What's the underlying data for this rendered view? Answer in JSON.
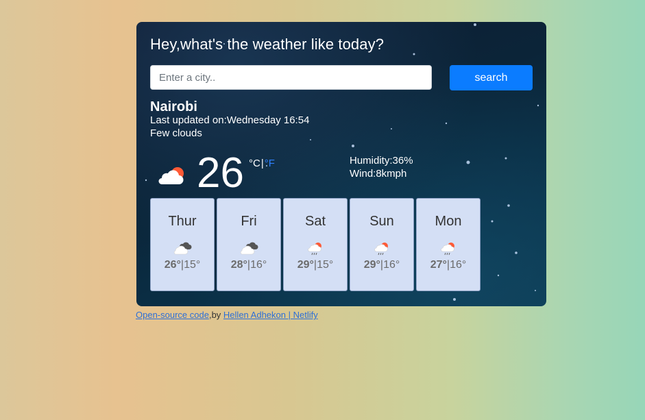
{
  "app": {
    "heading": "Hey,what's the weather like today?"
  },
  "search": {
    "placeholder": "Enter a city..",
    "value": "",
    "button_label": "search"
  },
  "current": {
    "city": "Nairobi",
    "last_updated": "Last updated on:Wednesday 16:54",
    "description": "Few clouds",
    "icon": "few-clouds-day-icon",
    "temperature": "26",
    "unit_celsius": "°C",
    "unit_separator": "|",
    "unit_fahrenheit": "°F",
    "humidity": "Humidity:36%",
    "wind": "Wind:8kmph"
  },
  "forecast": [
    {
      "day": "Thur",
      "icon": "broken-clouds-icon",
      "max": "26°",
      "min": "15°"
    },
    {
      "day": "Fri",
      "icon": "broken-clouds-icon",
      "max": "28°",
      "min": "16°"
    },
    {
      "day": "Sat",
      "icon": "rain-icon",
      "max": "29°",
      "min": "15°"
    },
    {
      "day": "Sun",
      "icon": "rain-icon",
      "max": "29°",
      "min": "16°"
    },
    {
      "day": "Mon",
      "icon": "rain-icon",
      "max": "27°",
      "min": "16°"
    }
  ],
  "footer": {
    "source_link": "Open-source code",
    "by_text": ",by ",
    "author_link": "Hellen Adhekon",
    "host_link": " | Netlify"
  },
  "colors": {
    "accent": "#0b7cff",
    "fahrenheit": "#2f80ff",
    "forecast_card": "#d4dff5",
    "sun": "#ff5a36"
  }
}
